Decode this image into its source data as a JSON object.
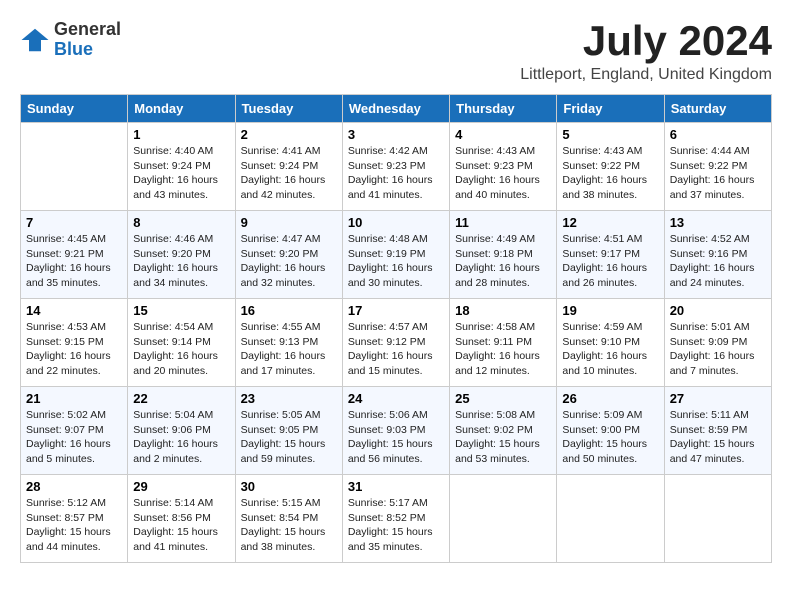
{
  "logo": {
    "general": "General",
    "blue": "Blue"
  },
  "title": "July 2024",
  "location": "Littleport, England, United Kingdom",
  "days_of_week": [
    "Sunday",
    "Monday",
    "Tuesday",
    "Wednesday",
    "Thursday",
    "Friday",
    "Saturday"
  ],
  "weeks": [
    [
      {
        "day": "",
        "sunrise": "",
        "sunset": "",
        "daylight": ""
      },
      {
        "day": "1",
        "sunrise": "Sunrise: 4:40 AM",
        "sunset": "Sunset: 9:24 PM",
        "daylight": "Daylight: 16 hours and 43 minutes."
      },
      {
        "day": "2",
        "sunrise": "Sunrise: 4:41 AM",
        "sunset": "Sunset: 9:24 PM",
        "daylight": "Daylight: 16 hours and 42 minutes."
      },
      {
        "day": "3",
        "sunrise": "Sunrise: 4:42 AM",
        "sunset": "Sunset: 9:23 PM",
        "daylight": "Daylight: 16 hours and 41 minutes."
      },
      {
        "day": "4",
        "sunrise": "Sunrise: 4:43 AM",
        "sunset": "Sunset: 9:23 PM",
        "daylight": "Daylight: 16 hours and 40 minutes."
      },
      {
        "day": "5",
        "sunrise": "Sunrise: 4:43 AM",
        "sunset": "Sunset: 9:22 PM",
        "daylight": "Daylight: 16 hours and 38 minutes."
      },
      {
        "day": "6",
        "sunrise": "Sunrise: 4:44 AM",
        "sunset": "Sunset: 9:22 PM",
        "daylight": "Daylight: 16 hours and 37 minutes."
      }
    ],
    [
      {
        "day": "7",
        "sunrise": "Sunrise: 4:45 AM",
        "sunset": "Sunset: 9:21 PM",
        "daylight": "Daylight: 16 hours and 35 minutes."
      },
      {
        "day": "8",
        "sunrise": "Sunrise: 4:46 AM",
        "sunset": "Sunset: 9:20 PM",
        "daylight": "Daylight: 16 hours and 34 minutes."
      },
      {
        "day": "9",
        "sunrise": "Sunrise: 4:47 AM",
        "sunset": "Sunset: 9:20 PM",
        "daylight": "Daylight: 16 hours and 32 minutes."
      },
      {
        "day": "10",
        "sunrise": "Sunrise: 4:48 AM",
        "sunset": "Sunset: 9:19 PM",
        "daylight": "Daylight: 16 hours and 30 minutes."
      },
      {
        "day": "11",
        "sunrise": "Sunrise: 4:49 AM",
        "sunset": "Sunset: 9:18 PM",
        "daylight": "Daylight: 16 hours and 28 minutes."
      },
      {
        "day": "12",
        "sunrise": "Sunrise: 4:51 AM",
        "sunset": "Sunset: 9:17 PM",
        "daylight": "Daylight: 16 hours and 26 minutes."
      },
      {
        "day": "13",
        "sunrise": "Sunrise: 4:52 AM",
        "sunset": "Sunset: 9:16 PM",
        "daylight": "Daylight: 16 hours and 24 minutes."
      }
    ],
    [
      {
        "day": "14",
        "sunrise": "Sunrise: 4:53 AM",
        "sunset": "Sunset: 9:15 PM",
        "daylight": "Daylight: 16 hours and 22 minutes."
      },
      {
        "day": "15",
        "sunrise": "Sunrise: 4:54 AM",
        "sunset": "Sunset: 9:14 PM",
        "daylight": "Daylight: 16 hours and 20 minutes."
      },
      {
        "day": "16",
        "sunrise": "Sunrise: 4:55 AM",
        "sunset": "Sunset: 9:13 PM",
        "daylight": "Daylight: 16 hours and 17 minutes."
      },
      {
        "day": "17",
        "sunrise": "Sunrise: 4:57 AM",
        "sunset": "Sunset: 9:12 PM",
        "daylight": "Daylight: 16 hours and 15 minutes."
      },
      {
        "day": "18",
        "sunrise": "Sunrise: 4:58 AM",
        "sunset": "Sunset: 9:11 PM",
        "daylight": "Daylight: 16 hours and 12 minutes."
      },
      {
        "day": "19",
        "sunrise": "Sunrise: 4:59 AM",
        "sunset": "Sunset: 9:10 PM",
        "daylight": "Daylight: 16 hours and 10 minutes."
      },
      {
        "day": "20",
        "sunrise": "Sunrise: 5:01 AM",
        "sunset": "Sunset: 9:09 PM",
        "daylight": "Daylight: 16 hours and 7 minutes."
      }
    ],
    [
      {
        "day": "21",
        "sunrise": "Sunrise: 5:02 AM",
        "sunset": "Sunset: 9:07 PM",
        "daylight": "Daylight: 16 hours and 5 minutes."
      },
      {
        "day": "22",
        "sunrise": "Sunrise: 5:04 AM",
        "sunset": "Sunset: 9:06 PM",
        "daylight": "Daylight: 16 hours and 2 minutes."
      },
      {
        "day": "23",
        "sunrise": "Sunrise: 5:05 AM",
        "sunset": "Sunset: 9:05 PM",
        "daylight": "Daylight: 15 hours and 59 minutes."
      },
      {
        "day": "24",
        "sunrise": "Sunrise: 5:06 AM",
        "sunset": "Sunset: 9:03 PM",
        "daylight": "Daylight: 15 hours and 56 minutes."
      },
      {
        "day": "25",
        "sunrise": "Sunrise: 5:08 AM",
        "sunset": "Sunset: 9:02 PM",
        "daylight": "Daylight: 15 hours and 53 minutes."
      },
      {
        "day": "26",
        "sunrise": "Sunrise: 5:09 AM",
        "sunset": "Sunset: 9:00 PM",
        "daylight": "Daylight: 15 hours and 50 minutes."
      },
      {
        "day": "27",
        "sunrise": "Sunrise: 5:11 AM",
        "sunset": "Sunset: 8:59 PM",
        "daylight": "Daylight: 15 hours and 47 minutes."
      }
    ],
    [
      {
        "day": "28",
        "sunrise": "Sunrise: 5:12 AM",
        "sunset": "Sunset: 8:57 PM",
        "daylight": "Daylight: 15 hours and 44 minutes."
      },
      {
        "day": "29",
        "sunrise": "Sunrise: 5:14 AM",
        "sunset": "Sunset: 8:56 PM",
        "daylight": "Daylight: 15 hours and 41 minutes."
      },
      {
        "day": "30",
        "sunrise": "Sunrise: 5:15 AM",
        "sunset": "Sunset: 8:54 PM",
        "daylight": "Daylight: 15 hours and 38 minutes."
      },
      {
        "day": "31",
        "sunrise": "Sunrise: 5:17 AM",
        "sunset": "Sunset: 8:52 PM",
        "daylight": "Daylight: 15 hours and 35 minutes."
      },
      {
        "day": "",
        "sunrise": "",
        "sunset": "",
        "daylight": ""
      },
      {
        "day": "",
        "sunrise": "",
        "sunset": "",
        "daylight": ""
      },
      {
        "day": "",
        "sunrise": "",
        "sunset": "",
        "daylight": ""
      }
    ]
  ]
}
